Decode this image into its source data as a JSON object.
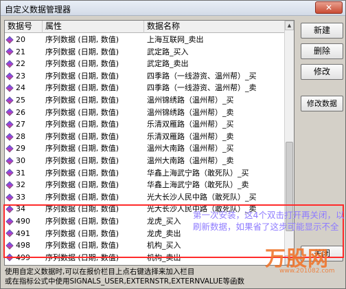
{
  "window": {
    "title": "自定义数据管理器",
    "close_glyph": "✕"
  },
  "list": {
    "headers": [
      "数据号",
      "属性",
      "数据名称"
    ],
    "rows": [
      {
        "id": "20",
        "attr": "序列数据 (日期, 数值)",
        "name": "上海互联网_卖出"
      },
      {
        "id": "21",
        "attr": "序列数据 (日期, 数值)",
        "name": "武定路_买入"
      },
      {
        "id": "22",
        "attr": "序列数据 (日期, 数值)",
        "name": "武定路_卖出"
      },
      {
        "id": "23",
        "attr": "序列数据 (日期, 数值)",
        "name": "四季路（一线游资、温州帮）_买"
      },
      {
        "id": "24",
        "attr": "序列数据 (日期, 数值)",
        "name": "四季路（一线游资、温州帮）_卖"
      },
      {
        "id": "25",
        "attr": "序列数据 (日期, 数值)",
        "name": "温州锦绣路（温州帮）_买"
      },
      {
        "id": "26",
        "attr": "序列数据 (日期, 数值)",
        "name": "温州锦绣路（温州帮）_卖"
      },
      {
        "id": "27",
        "attr": "序列数据 (日期, 数值)",
        "name": "乐清双雁路（温州帮）_买"
      },
      {
        "id": "28",
        "attr": "序列数据 (日期, 数值)",
        "name": "乐清双雁路（温州帮）_卖"
      },
      {
        "id": "29",
        "attr": "序列数据 (日期, 数值)",
        "name": "温州大南路（温州帮）_买"
      },
      {
        "id": "30",
        "attr": "序列数据 (日期, 数值)",
        "name": "温州大南路（温州帮）_卖"
      },
      {
        "id": "31",
        "attr": "序列数据 (日期, 数值)",
        "name": "华鑫上海武宁路（敢死队）_买"
      },
      {
        "id": "32",
        "attr": "序列数据 (日期, 数值)",
        "name": "华鑫上海武宁路（敢死队）_卖"
      },
      {
        "id": "33",
        "attr": "序列数据 (日期, 数值)",
        "name": "光大长沙人民中路（敢死队）_买"
      },
      {
        "id": "34",
        "attr": "序列数据 (日期, 数值)",
        "name": "光大长沙人民中路（敢死队）_卖"
      },
      {
        "id": "490",
        "attr": "序列数据 (日期, 数值)",
        "name": "龙虎_买入"
      },
      {
        "id": "491",
        "attr": "序列数据 (日期, 数值)",
        "name": "龙虎_卖出"
      },
      {
        "id": "498",
        "attr": "序列数据 (日期, 数值)",
        "name": "机构_买入"
      },
      {
        "id": "499",
        "attr": "序列数据 (日期, 数值)",
        "name": "机构_卖出"
      }
    ]
  },
  "buttons": {
    "new": "新建",
    "delete": "删除",
    "modify": "修改",
    "modify_data": "修改数据",
    "close": "关闭"
  },
  "annotation": "第一次安装，这4个双击打开再关闭，以刷新数据，如果省了这步可能显示不全",
  "footer": {
    "line1": "使用自定义数据时,可以在报价栏目上点右键选择来加入栏目",
    "line2": "或在指标公式中使用SIGNALS_USER,EXTERNSTR,EXTERNVALUE等函数"
  },
  "watermark": {
    "logo": "万股网",
    "url": "www.201082.com"
  },
  "colors": {
    "highlight_border": "#ff2a2a",
    "annotation_text": "#8f7cff",
    "watermark": "#f0762d"
  }
}
